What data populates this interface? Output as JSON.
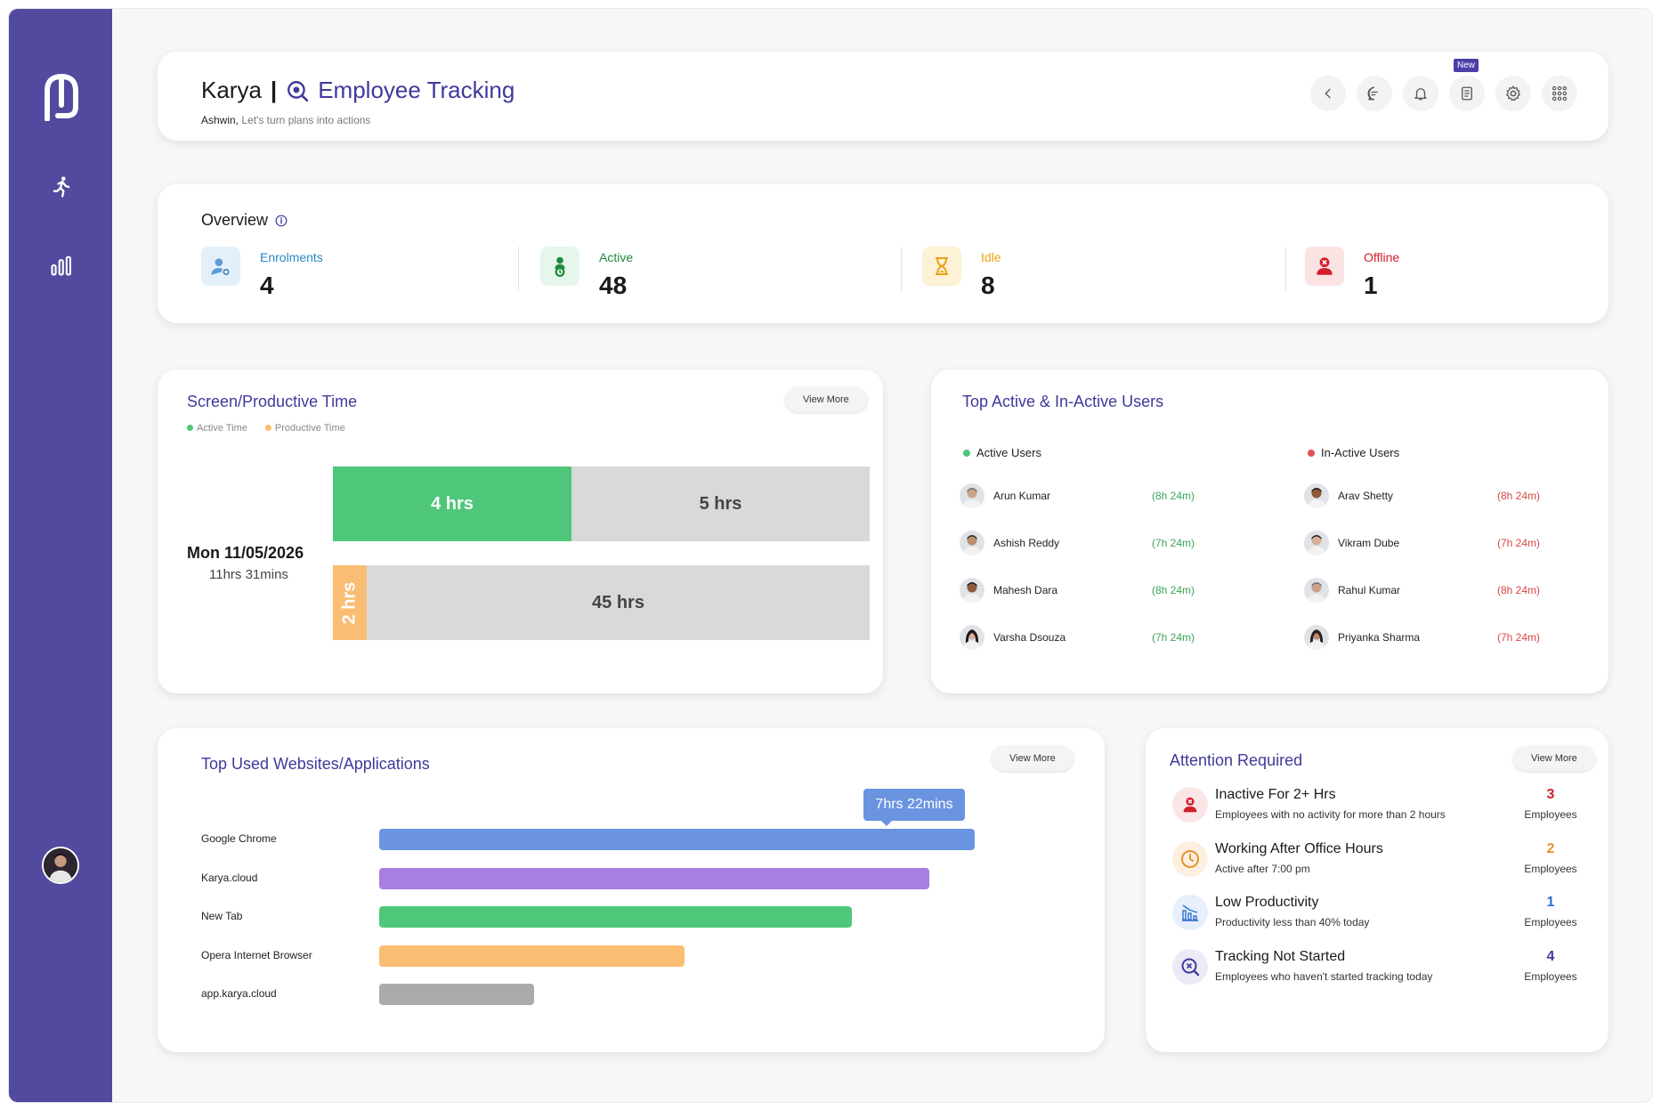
{
  "header": {
    "app_name": "Karya",
    "separator": "|",
    "module": "Employee Tracking",
    "user_name": "Ashwin,",
    "tagline": "Let's turn plans into actions",
    "new_badge": "New"
  },
  "overview": {
    "title": "Overview",
    "stats": [
      {
        "label": "Enrolments",
        "value": "4",
        "color": "#2d88c7"
      },
      {
        "label": "Active",
        "value": "48",
        "color": "#1f8a3c"
      },
      {
        "label": "Idle",
        "value": "8",
        "color": "#e8a317"
      },
      {
        "label": "Offline",
        "value": "1",
        "color": "#d21e2b"
      }
    ]
  },
  "screen_time": {
    "title": "Screen/Productive Time",
    "view_more": "View More",
    "legend": [
      {
        "label": "Active Time",
        "color": "#4fc77a"
      },
      {
        "label": "Productive Time",
        "color": "#f9bd73"
      }
    ],
    "date": "Mon 11/05/2026",
    "duration": "11hrs 31mins",
    "chart_data": {
      "type": "bar",
      "series": [
        {
          "name": "Active Time",
          "segments": [
            {
              "label": "4 hrs",
              "value": 4
            },
            {
              "label": "5 hrs",
              "value": 5
            }
          ]
        },
        {
          "name": "Productive Time",
          "segments": [
            {
              "label": "2 hrs",
              "value": 2
            },
            {
              "label": "45 hrs",
              "value": 45
            }
          ]
        }
      ]
    }
  },
  "top_users": {
    "title": "Top Active & In-Active Users",
    "active_label": "Active Users",
    "inactive_label": "In-Active Users",
    "active": [
      {
        "name": "Arun Kumar",
        "time": "(8h 24m)"
      },
      {
        "name": "Ashish Reddy",
        "time": "(7h 24m)"
      },
      {
        "name": "Mahesh Dara",
        "time": "(8h 24m)"
      },
      {
        "name": "Varsha Dsouza",
        "time": "(7h 24m)"
      }
    ],
    "inactive": [
      {
        "name": "Arav Shetty",
        "time": "(8h 24m)"
      },
      {
        "name": "Vikram Dube",
        "time": "(7h 24m)"
      },
      {
        "name": "Rahul Kumar",
        "time": "(8h 24m)"
      },
      {
        "name": "Priyanka Sharma",
        "time": "(7h 24m)"
      }
    ]
  },
  "websites": {
    "title": "Top Used Websites/Applications",
    "view_more": "View More",
    "tooltip": "7hrs 22mins",
    "chart_data": {
      "type": "bar",
      "categories": [
        "Google Chrome",
        "Karya.cloud",
        "New Tab",
        "Opera Internet Browser",
        "app.karya.cloud"
      ],
      "values": [
        1.0,
        0.924,
        0.794,
        0.512,
        0.26
      ],
      "colors": [
        "#6a94e0",
        "#a77ee2",
        "#4fc77a",
        "#f9bd73",
        "#aaaaaa"
      ]
    }
  },
  "attention": {
    "title": "Attention Required",
    "view_more": "View More",
    "items": [
      {
        "title": "Inactive For 2+ Hrs",
        "desc": "Employees with no activity for more than 2 hours",
        "count": "3",
        "unit": "Employees",
        "color": "#d21e2b",
        "icon": "user-x-icon"
      },
      {
        "title": "Working After Office Hours",
        "desc": "Active after 7:00 pm",
        "count": "2",
        "unit": "Employees",
        "color": "#e8932a",
        "icon": "clock-icon"
      },
      {
        "title": "Low Productivity",
        "desc": "Productivity less than 40% today",
        "count": "1",
        "unit": "Employees",
        "color": "#2d6fd1",
        "icon": "chart-down-icon"
      },
      {
        "title": "Tracking Not Started",
        "desc": "Employees who haven't started tracking today",
        "count": "4",
        "unit": "Employees",
        "color": "#3f3a9a",
        "icon": "search-x-icon"
      }
    ]
  }
}
